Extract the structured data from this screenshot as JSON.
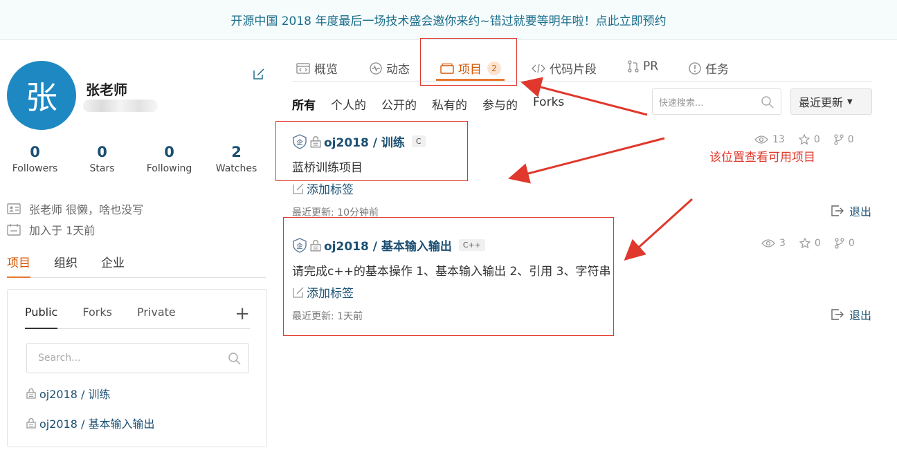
{
  "banner": {
    "text": "开源中国 2018 年度最后一场技术盛会邀你来约~错过就要等明年啦！点此立即预约"
  },
  "profile": {
    "avatar_char": "张",
    "name": "张老师",
    "stats": [
      {
        "value": "0",
        "label": "Followers"
      },
      {
        "value": "0",
        "label": "Stars"
      },
      {
        "value": "0",
        "label": "Following"
      },
      {
        "value": "2",
        "label": "Watches"
      }
    ],
    "bio": "张老师 很懒，啥也没写",
    "joined": "加入于 1天前",
    "tabs": [
      "项目",
      "组织",
      "企业"
    ]
  },
  "side_card": {
    "tabs": [
      "Public",
      "Forks",
      "Private"
    ],
    "search_placeholder": "Search...",
    "repos": [
      "oj2018 / 训练",
      "oj2018 / 基本输入输出"
    ]
  },
  "main": {
    "tabs": [
      {
        "label": "概览",
        "icon": "overview-icon"
      },
      {
        "label": "动态",
        "icon": "activity-icon"
      },
      {
        "label": "项目",
        "icon": "project-icon",
        "count": "2"
      },
      {
        "label": "代码片段",
        "icon": "code-icon"
      },
      {
        "label": "PR",
        "icon": "pull-request-icon"
      },
      {
        "label": "任务",
        "icon": "issue-icon"
      }
    ],
    "filters": [
      "所有",
      "个人的",
      "公开的",
      "私有的",
      "参与的",
      "Forks"
    ],
    "search_placeholder": "快速搜索...",
    "sort_label": "最近更新",
    "repos": [
      {
        "title": "oj2018 / 训练",
        "lang": "C",
        "desc": "蓝桥训练项目",
        "tag": "添加标签",
        "updated": "最近更新: 10分钟前",
        "watch": "13",
        "star": "0",
        "fork": "0",
        "exit": "退出"
      },
      {
        "title": "oj2018 / 基本输入输出",
        "lang": "C++",
        "desc": "请完成c++的基本操作 1、基本输入输出 2、引用 3、字符串",
        "tag": "添加标签",
        "updated": "最近更新: 1天前",
        "watch": "3",
        "star": "0",
        "fork": "0",
        "exit": "退出"
      }
    ]
  },
  "annotation": {
    "text": "该位置查看可用项目",
    "color": "#e0382c"
  },
  "colors": {
    "accent": "#e8772e",
    "link": "#1b4f72",
    "avatar": "#1e88c3"
  }
}
